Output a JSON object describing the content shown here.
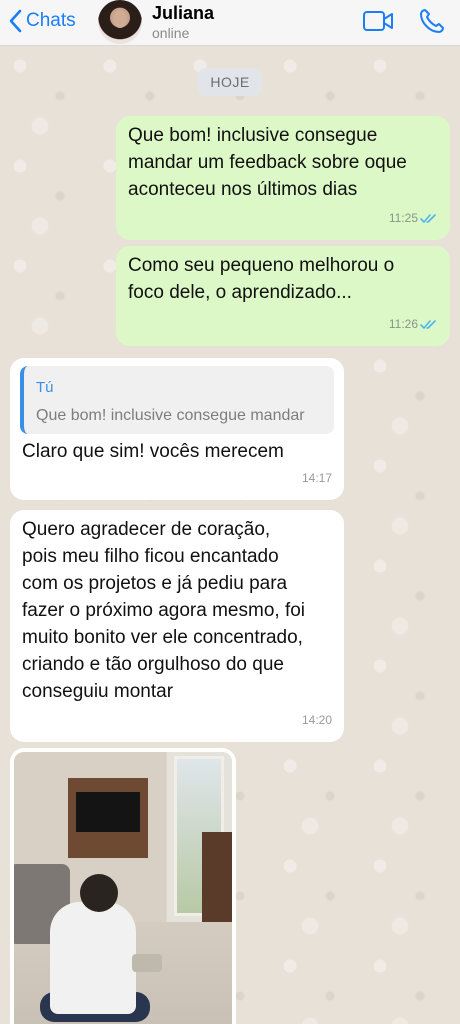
{
  "header": {
    "back_label": "Chats",
    "contact_name": "Juliana",
    "contact_status": "online"
  },
  "chat": {
    "date_chip": "HOJE",
    "messages": [
      {
        "direction": "out",
        "lines": [
          "Que bom! inclusive consegue",
          "mandar um feedback sobre oque",
          "aconteceu nos últimos dias"
        ],
        "time": "11:25"
      },
      {
        "direction": "out",
        "lines": [
          "Como seu pequeno melhorou o",
          "foco dele, o aprendizado..."
        ],
        "time": "11:26"
      },
      {
        "direction": "in",
        "quote_author": "Tú",
        "quote_text": "Que bom! inclusive consegue mandar",
        "lines": [
          "Claro que sim! vocês merecem"
        ],
        "time": "14:17"
      },
      {
        "direction": "in",
        "lines": [
          "Quero agradecer de coração,",
          "pois meu filho ficou encantado",
          "com os projetos e já pediu para",
          "fazer o próximo agora mesmo, foi",
          "muito bonito ver ele concentrado,",
          "criando e tão orgulhoso do que",
          "conseguiu montar"
        ],
        "time": "14:20"
      }
    ]
  },
  "colors": {
    "accent": "#1a7ef7",
    "outgoing_bubble": "#dcf8c6",
    "incoming_bubble": "#ffffff",
    "read_ticks": "#4fb6ec"
  },
  "icons": {
    "back": "chevron-left-icon",
    "video": "video-camera-icon",
    "call": "phone-icon",
    "ticks": "double-check-icon"
  }
}
